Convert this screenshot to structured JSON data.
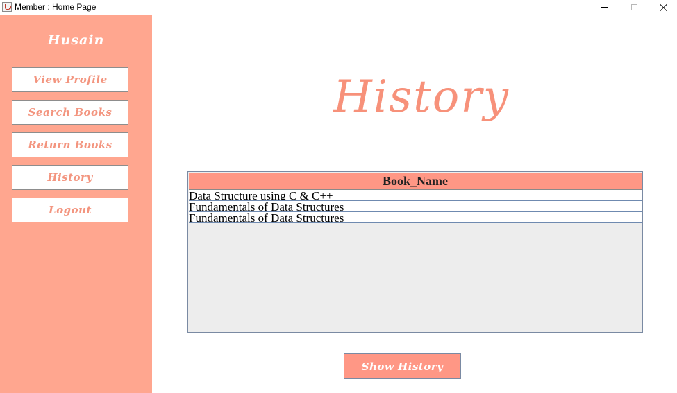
{
  "window": {
    "title": "Member : Home Page",
    "controls": {
      "minimize_icon": "minimize-icon",
      "maximize_icon": "maximize-icon",
      "close_icon": "close-icon"
    }
  },
  "sidebar": {
    "username": "Husain",
    "items": [
      {
        "label": "View Profile"
      },
      {
        "label": "Search Books"
      },
      {
        "label": "Return Books"
      },
      {
        "label": "History"
      },
      {
        "label": "Logout"
      }
    ]
  },
  "main": {
    "heading": "History",
    "table": {
      "columns": [
        "Book_Name"
      ],
      "rows": [
        [
          "Data Structure using C & C++"
        ],
        [
          "Fundamentals of Data Structures"
        ],
        [
          "Fundamentals of Data Structures"
        ]
      ]
    },
    "show_button_label": "Show History"
  },
  "colors": {
    "sidebar_bg": "#ffa68f",
    "accent": "#f7917a",
    "header_bg": "#ff9785",
    "content_bg": "#ededed"
  }
}
